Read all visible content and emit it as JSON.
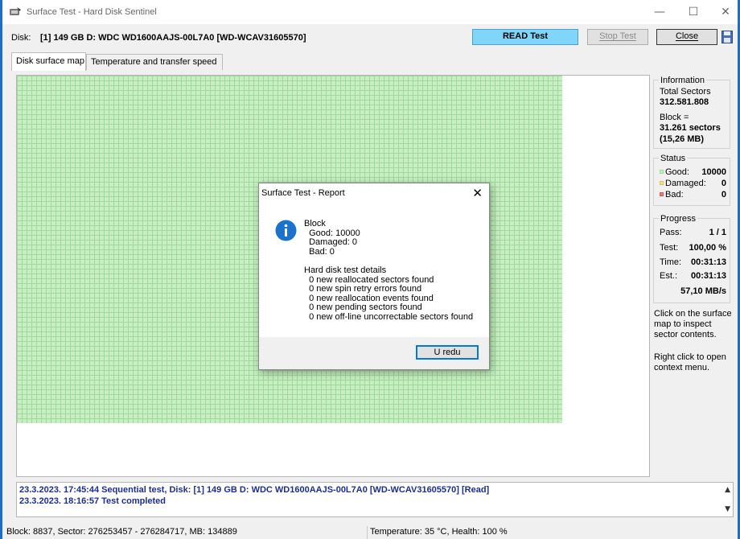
{
  "window": {
    "title": "Surface Test - Hard Disk Sentinel",
    "controls": {
      "minimize": "—",
      "maximize": "☐",
      "close": "✕"
    }
  },
  "disk": {
    "label": "Disk:",
    "value": "[1] 149 GB D: WDC WD1600AAJS-00L7A0 [WD-WCAV31605570]"
  },
  "buttons": {
    "read_test": "READ Test",
    "stop_test": "Stop Test",
    "close": "Close"
  },
  "tabs": [
    {
      "label": "Disk surface map",
      "active": true
    },
    {
      "label": "Temperature and transfer speed",
      "active": false
    }
  ],
  "information": {
    "title": "Information",
    "total_sectors_label": "Total Sectors",
    "total_sectors_value": "312.581.808",
    "block_label": "Block =",
    "block_sectors": "31.261 sectors",
    "block_size": "(15,26 MB)"
  },
  "status": {
    "title": "Status",
    "good_label": "Good:",
    "good_value": "10000",
    "damaged_label": "Damaged:",
    "damaged_value": "0",
    "bad_label": "Bad:",
    "bad_value": "0"
  },
  "progress": {
    "title": "Progress",
    "pass_label": "Pass:",
    "pass_value": "1 / 1",
    "test_label": "Test:",
    "test_value": "100,00 %",
    "time_label": "Time:",
    "time_value": "00:31:13",
    "est_label": "Est.:",
    "est_value": "00:31:13",
    "speed": "57,10 MB/s"
  },
  "hints": {
    "inspect": "Click on the surface map to inspect sector contents.",
    "context": "Right click to open context menu."
  },
  "log": [
    "23.3.2023.  17:45:44  Sequential test, Disk: [1] 149 GB D: WDC WD1600AAJS-00L7A0 [WD-WCAV31605570] [Read]",
    "23.3.2023.  18:16:57  Test completed"
  ],
  "statusbar": {
    "block_info": "Block: 8837, Sector: 276253457 - 276284717, MB: 134889",
    "health": "Temperature: 35  °C,  Health: 100 %"
  },
  "dialog": {
    "title": "Surface Test - Report",
    "close_glyph": "✕",
    "body": "Block\n  Good: 10000\n  Damaged: 0\n  Bad: 0\n\nHard disk test details\n  0 new reallocated sectors found\n  0 new spin retry errors found\n  0 new reallocation events found\n  0 new pending sectors found\n  0 new off-line uncorrectable sectors found",
    "ok_label": "U redu",
    "icon": "info-icon"
  },
  "colors": {
    "accent": "#1e6ec8",
    "read_button": "#7fd6f8",
    "good": "#c8efc3",
    "damaged": "#f5e08a",
    "bad": "#e68080",
    "log_text": "#1d2f8c"
  }
}
